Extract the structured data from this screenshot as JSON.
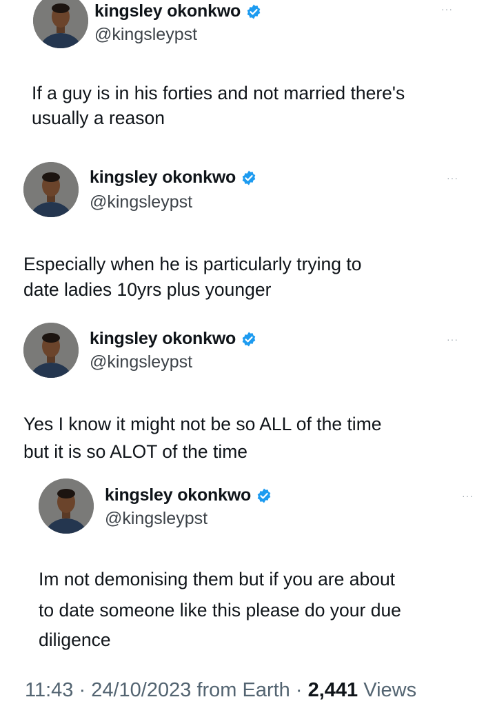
{
  "thread": [
    {
      "author_name": "kingsley okonkwo",
      "handle": "@kingsleypst",
      "verified_icon": "verified-badge-icon",
      "text_lines": [
        "If a guy is in his forties and not married there's",
        "usually a reason"
      ]
    },
    {
      "author_name": "kingsley okonkwo",
      "handle": "@kingsleypst",
      "verified_icon": "verified-badge-icon",
      "text_lines": [
        "Especially when he is particularly trying to",
        "date ladies 10yrs plus younger"
      ]
    },
    {
      "author_name": "kingsley okonkwo",
      "handle": "@kingsleypst",
      "verified_icon": "verified-badge-icon",
      "text_lines": [
        "Yes I know it might not be so ALL of the time",
        "but it is so ALOT of the time"
      ]
    },
    {
      "author_name": "kingsley okonkwo",
      "handle": "@kingsleypst",
      "verified_icon": "verified-badge-icon",
      "text_lines": [
        "Im not demonising them but if you are about",
        "to date someone like this please do your due",
        "diligence"
      ]
    }
  ],
  "footer": {
    "time": "11:43",
    "separator": "·",
    "date": "24/10/2023",
    "source": "from Earth",
    "views_count": "2,441",
    "views_label": "Views"
  },
  "colors": {
    "text": "#0f1419",
    "secondary": "#536471",
    "verified": "#1d9bf0"
  }
}
